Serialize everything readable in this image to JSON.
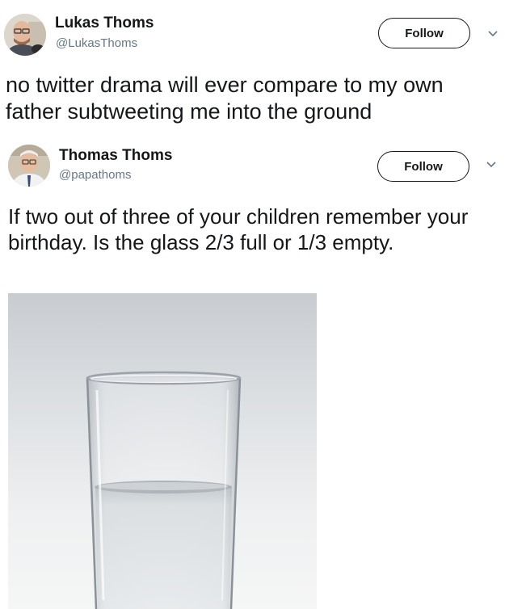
{
  "tweets": [
    {
      "author": {
        "name": "Lukas Thoms",
        "handle": "@LukasThoms"
      },
      "follow_label": "Follow",
      "text": "no twitter drama will ever compare to my own father subtweeting me into the ground"
    },
    {
      "author": {
        "name": "Thomas Thoms",
        "handle": "@papathoms"
      },
      "follow_label": "Follow",
      "text": "If two out of three of your children remember your birthday. Is the glass 2/3 full or 1/3 empty."
    }
  ],
  "icons": {
    "menu": "chevron-down-icon",
    "avatar": "avatar"
  },
  "colors": {
    "text": "#14171a",
    "secondary_text": "#657786",
    "button_border": "#14171a"
  }
}
